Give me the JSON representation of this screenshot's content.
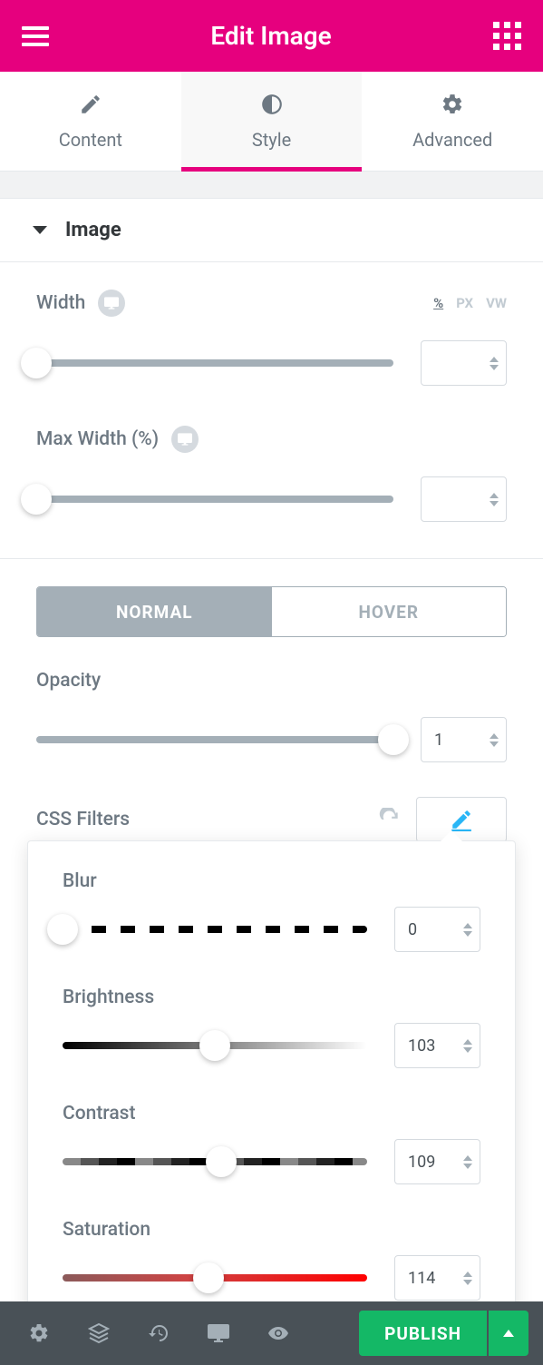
{
  "header": {
    "title": "Edit Image"
  },
  "tabs": {
    "content": "Content",
    "style": "Style",
    "advanced": "Advanced"
  },
  "section": {
    "title": "Image"
  },
  "width": {
    "label": "Width",
    "units": [
      "%",
      "PX",
      "VW"
    ],
    "active": "%",
    "value": ""
  },
  "maxw": {
    "label": "Max Width (%)",
    "value": ""
  },
  "state": {
    "normal": "NORMAL",
    "hover": "HOVER"
  },
  "opacity": {
    "label": "Opacity",
    "value": "1"
  },
  "cssf": {
    "label": "CSS Filters"
  },
  "filters": {
    "blur": {
      "label": "Blur",
      "value": "0",
      "pos": 0
    },
    "bri": {
      "label": "Brightness",
      "value": "103",
      "pos": 50
    },
    "con": {
      "label": "Contrast",
      "value": "109",
      "pos": 52
    },
    "sat": {
      "label": "Saturation",
      "value": "114",
      "pos": 48
    }
  },
  "footer": {
    "publish": "PUBLISH"
  }
}
